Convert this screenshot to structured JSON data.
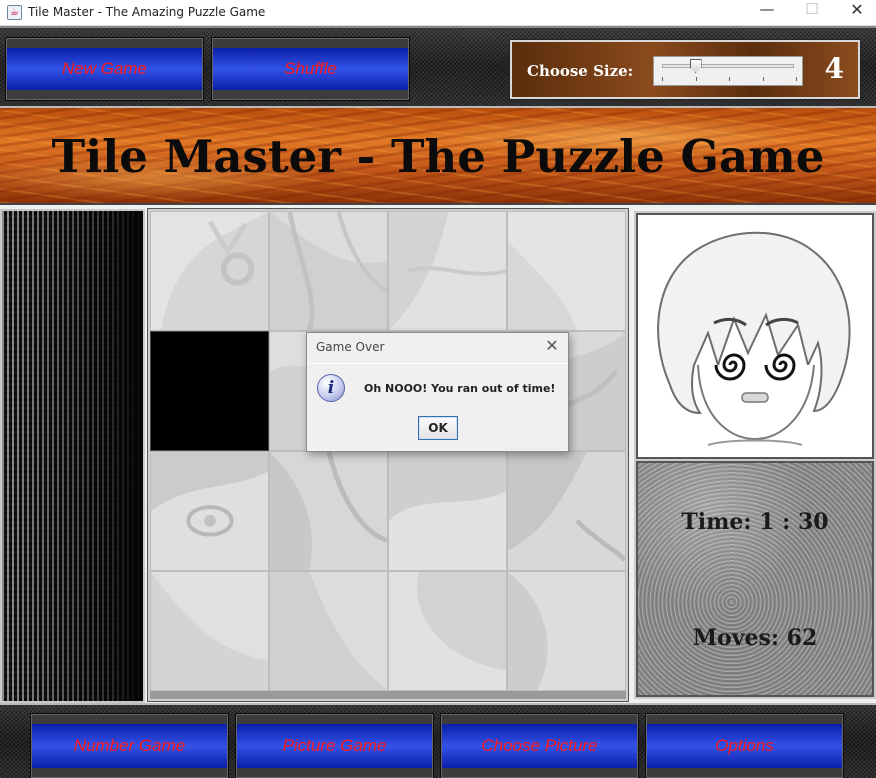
{
  "window": {
    "title": "Tile Master - The Amazing Puzzle Game",
    "app_icon": "java-coffee-icon",
    "controls": {
      "minimize": "—",
      "maximize": "☐",
      "close": "✕"
    }
  },
  "toolbar": {
    "new_game_label": "New Game",
    "shuffle_label": "Shuffle",
    "size": {
      "label": "Choose Size:",
      "value": "4",
      "slider_min": 2,
      "slider_max": 10,
      "slider_value": 4
    }
  },
  "banner": {
    "title": "Tile Master - The Puzzle Game"
  },
  "board": {
    "rows": 4,
    "cols": 4,
    "empty_tile": {
      "row": 1,
      "col": 0
    }
  },
  "stats": {
    "time": "Time: 1 : 30",
    "moves": "Moves: 62"
  },
  "bottom_toolbar": {
    "number_game_label": "Number Game",
    "picture_game_label": "Picture Game",
    "choose_picture_label": "Choose Picture",
    "options_label": "Options"
  },
  "dialog": {
    "title": "Game Over",
    "message": "Oh NOOO! You ran out of time!",
    "ok_label": "OK",
    "icon": "info-icon",
    "close_icon": "close-icon"
  },
  "colors": {
    "button_text": "#ff1a1a",
    "button_blue": "#3252e8",
    "banner_orange": "#e27825",
    "wood_brown": "#8a4a1c"
  }
}
